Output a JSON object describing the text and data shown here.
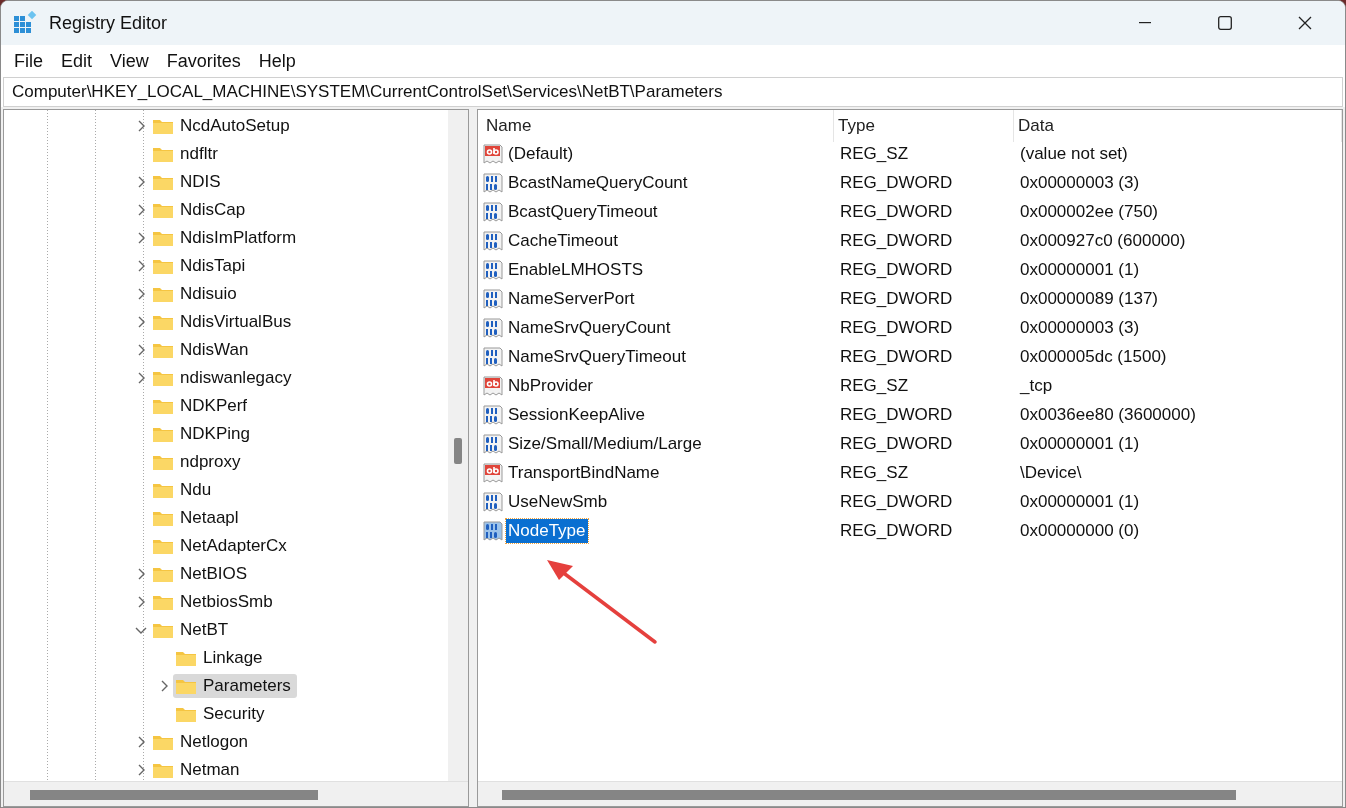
{
  "window": {
    "title": "Registry Editor"
  },
  "menu": [
    "File",
    "Edit",
    "View",
    "Favorites",
    "Help"
  ],
  "address": "Computer\\HKEY_LOCAL_MACHINE\\SYSTEM\\CurrentControlSet\\Services\\NetBT\\Parameters",
  "tree": {
    "items": [
      {
        "label": "NcdAutoSetup",
        "expandable": true,
        "expanded": false,
        "selected": false
      },
      {
        "label": "ndfltr",
        "expandable": false,
        "expanded": false,
        "selected": false
      },
      {
        "label": "NDIS",
        "expandable": true,
        "expanded": false,
        "selected": false
      },
      {
        "label": "NdisCap",
        "expandable": true,
        "expanded": false,
        "selected": false
      },
      {
        "label": "NdisImPlatform",
        "expandable": true,
        "expanded": false,
        "selected": false
      },
      {
        "label": "NdisTapi",
        "expandable": true,
        "expanded": false,
        "selected": false
      },
      {
        "label": "Ndisuio",
        "expandable": true,
        "expanded": false,
        "selected": false
      },
      {
        "label": "NdisVirtualBus",
        "expandable": true,
        "expanded": false,
        "selected": false
      },
      {
        "label": "NdisWan",
        "expandable": true,
        "expanded": false,
        "selected": false
      },
      {
        "label": "ndiswanlegacy",
        "expandable": true,
        "expanded": false,
        "selected": false
      },
      {
        "label": "NDKPerf",
        "expandable": false,
        "expanded": false,
        "selected": false
      },
      {
        "label": "NDKPing",
        "expandable": false,
        "expanded": false,
        "selected": false
      },
      {
        "label": "ndproxy",
        "expandable": false,
        "expanded": false,
        "selected": false
      },
      {
        "label": "Ndu",
        "expandable": false,
        "expanded": false,
        "selected": false
      },
      {
        "label": "Netaapl",
        "expandable": false,
        "expanded": false,
        "selected": false
      },
      {
        "label": "NetAdapterCx",
        "expandable": false,
        "expanded": false,
        "selected": false
      },
      {
        "label": "NetBIOS",
        "expandable": true,
        "expanded": false,
        "selected": false
      },
      {
        "label": "NetbiosSmb",
        "expandable": true,
        "expanded": false,
        "selected": false
      },
      {
        "label": "NetBT",
        "expandable": true,
        "expanded": true,
        "selected": false,
        "children": [
          {
            "label": "Linkage",
            "expandable": false,
            "expanded": false,
            "selected": false
          },
          {
            "label": "Parameters",
            "expandable": true,
            "expanded": false,
            "selected": true
          },
          {
            "label": "Security",
            "expandable": false,
            "expanded": false,
            "selected": false
          }
        ]
      },
      {
        "label": "Netlogon",
        "expandable": true,
        "expanded": false,
        "selected": false
      },
      {
        "label": "Netman",
        "expandable": true,
        "expanded": false,
        "selected": false
      }
    ]
  },
  "values": {
    "columns": [
      "Name",
      "Type",
      "Data"
    ],
    "rows": [
      {
        "kind": "string",
        "name": "(Default)",
        "type": "REG_SZ",
        "data": "(value not set)",
        "selected": false
      },
      {
        "kind": "dword",
        "name": "BcastNameQueryCount",
        "type": "REG_DWORD",
        "data": "0x00000003 (3)",
        "selected": false
      },
      {
        "kind": "dword",
        "name": "BcastQueryTimeout",
        "type": "REG_DWORD",
        "data": "0x000002ee (750)",
        "selected": false
      },
      {
        "kind": "dword",
        "name": "CacheTimeout",
        "type": "REG_DWORD",
        "data": "0x000927c0 (600000)",
        "selected": false
      },
      {
        "kind": "dword",
        "name": "EnableLMHOSTS",
        "type": "REG_DWORD",
        "data": "0x00000001 (1)",
        "selected": false
      },
      {
        "kind": "dword",
        "name": "NameServerPort",
        "type": "REG_DWORD",
        "data": "0x00000089 (137)",
        "selected": false
      },
      {
        "kind": "dword",
        "name": "NameSrvQueryCount",
        "type": "REG_DWORD",
        "data": "0x00000003 (3)",
        "selected": false
      },
      {
        "kind": "dword",
        "name": "NameSrvQueryTimeout",
        "type": "REG_DWORD",
        "data": "0x000005dc (1500)",
        "selected": false
      },
      {
        "kind": "string",
        "name": "NbProvider",
        "type": "REG_SZ",
        "data": "_tcp",
        "selected": false
      },
      {
        "kind": "dword",
        "name": "SessionKeepAlive",
        "type": "REG_DWORD",
        "data": "0x0036ee80 (3600000)",
        "selected": false
      },
      {
        "kind": "dword",
        "name": "Size/Small/Medium/Large",
        "type": "REG_DWORD",
        "data": "0x00000001 (1)",
        "selected": false
      },
      {
        "kind": "string",
        "name": "TransportBindName",
        "type": "REG_SZ",
        "data": "\\Device\\",
        "selected": false
      },
      {
        "kind": "dword",
        "name": "UseNewSmb",
        "type": "REG_DWORD",
        "data": "0x00000001 (1)",
        "selected": false
      },
      {
        "kind": "dword",
        "name": "NodeType",
        "type": "REG_DWORD",
        "data": "0x00000000 (0)",
        "selected": true
      }
    ]
  }
}
